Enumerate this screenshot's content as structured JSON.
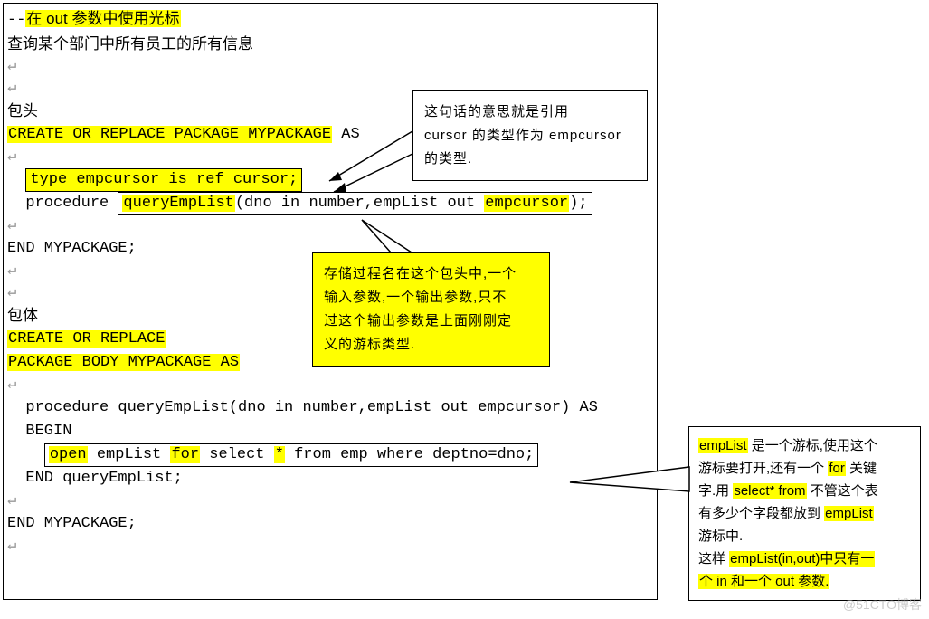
{
  "code": {
    "l1_prefix": "--",
    "l1_hl": "在 out 参数中使用光标",
    "l2": "查询某个部门中所有员工的所有信息",
    "l3": "包头",
    "l4_hl": "CREATE OR REPLACE PACKAGE MYPACKAGE",
    "l4_sfx": " AS",
    "l5_box": "type empcursor is ref cursor;",
    "l6a": "  procedure ",
    "l6_box1": "queryEmpList",
    "l6b": "(dno in number,empList out ",
    "l6_box2": "empcursor",
    "l6c": ");",
    "l7": "END MYPACKAGE;",
    "l8": "包体",
    "l9a": "CREATE OR REPLACE",
    "l9b": "PACKAGE BODY MYPACKAGE AS",
    "l10": "  procedure queryEmpList(dno in number,empList out empcursor) AS",
    "l11": "  BEGIN",
    "l12a": "    ",
    "l12_open": "open",
    "l12b": " empList ",
    "l12_for": "for",
    "l12c": " select ",
    "l12_star": "*",
    "l12d": " from emp where deptno=dno;",
    "l13": "  END queryEmpList;",
    "l14": "END MYPACKAGE;"
  },
  "callout1": {
    "t1a": "这句话的意思就是引用",
    "t2a": "cursor 的类型作为 empcursor",
    "t3a": "的类型."
  },
  "callout2": {
    "t1": "存储过程名在这个包头中,一个",
    "t2": "输入参数,一个输出参数,只不",
    "t3": "过这个输出参数是上面刚刚定",
    "t4": "义的游标类型."
  },
  "callout3": {
    "t1a": "empList",
    "t1b": " 是一个游标,使用这个",
    "t2a": "游标要打开,还有一个 ",
    "t2b": "for",
    "t2c": " 关键",
    "t3a": "字.用 ",
    "t3b": "select* from",
    "t3c": " 不管这个表",
    "t4a": "有多少个字段都放到 ",
    "t4b": "empList",
    "t5a": "游标中.",
    "t6a": "这样 ",
    "t6b": "empList(in,out)中只有一",
    "t7a": "个 in 和一个 out 参数."
  },
  "watermark": "@51CTO博客"
}
